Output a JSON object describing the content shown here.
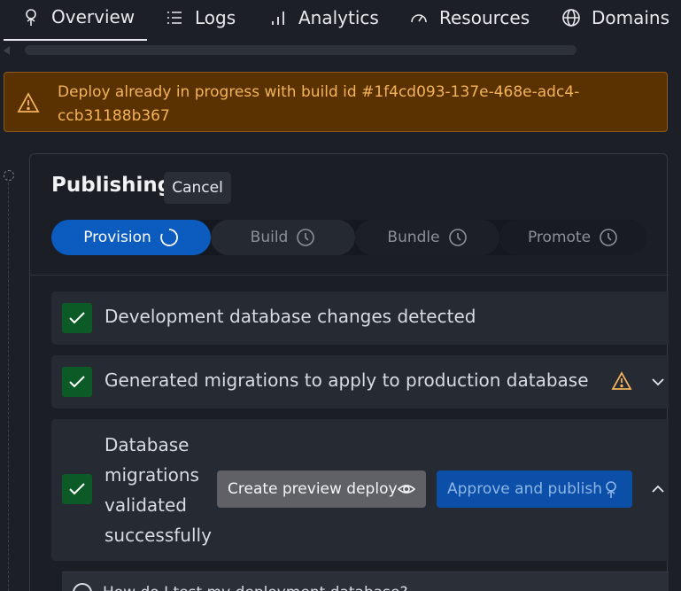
{
  "tabs": {
    "overview": "Overview",
    "logs": "Logs",
    "analytics": "Analytics",
    "resources": "Resources",
    "domains": "Domains"
  },
  "alert": {
    "line1": "Deploy already in progress with build id #1f4cd093-137e-468e-adc4-",
    "line2": "ccb31188b367",
    "color": "#f4b35a"
  },
  "publishing": {
    "title": "Publishing",
    "cancel_label": "Cancel",
    "steps": [
      {
        "label": "Provision",
        "status": "in-progress",
        "icon": "spinner-icon"
      },
      {
        "label": "Build",
        "status": "pending",
        "icon": "clock-icon"
      },
      {
        "label": "Bundle",
        "status": "pending",
        "icon": "clock-icon"
      },
      {
        "label": "Promote",
        "status": "pending",
        "icon": "clock-icon"
      }
    ],
    "checks": [
      {
        "label": "Development database changes detected",
        "status": "done"
      },
      {
        "label": "Generated migrations to apply to production database",
        "status": "done",
        "warning": true
      },
      {
        "label": "Database migrations validated successfully",
        "status": "done"
      }
    ],
    "preview_button": "Create preview deploy",
    "approve_button": "Approve and publish",
    "faq": "How do I test my deployment database?"
  },
  "colors": {
    "accent": "#0c5cc0",
    "success": "#0c5a25",
    "warning_bg": "#5a3100",
    "warning_text": "#f4b35a"
  }
}
